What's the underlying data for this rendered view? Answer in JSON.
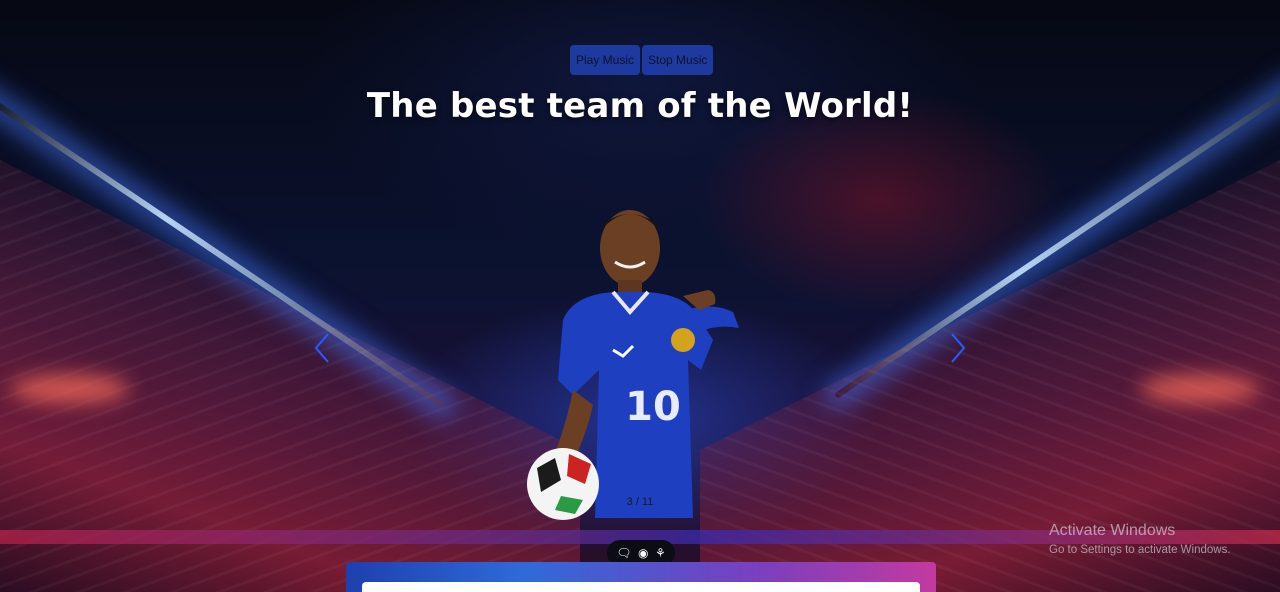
{
  "music": {
    "play_label": "Play Music",
    "stop_label": "Stop Music"
  },
  "hero": {
    "title": "The best team of the World!"
  },
  "carousel": {
    "counter": "3 / 11",
    "player_number": "10"
  },
  "watermark": {
    "title": "Activate Windows",
    "subtitle": "Go to Settings to activate Windows."
  },
  "colors": {
    "accent": "#1f3a9e",
    "jersey": "#1e3fbf"
  }
}
